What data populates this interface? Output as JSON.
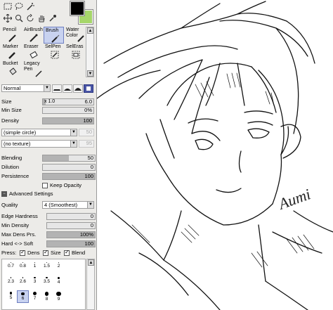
{
  "colors": {
    "foreground": "#000000",
    "background": "#a6d66a",
    "selection": "#c8d2f0"
  },
  "tools": {
    "icons": [
      "selection-tool-icon",
      "lasso-tool-icon",
      "magic-wand-icon",
      "move-tool-icon",
      "zoom-icon",
      "rotate-icon",
      "hand-icon",
      "eyedropper-icon"
    ]
  },
  "brushes": {
    "items": [
      {
        "label": "Pencil",
        "icon": "pencil-icon"
      },
      {
        "label": "AirBrush",
        "icon": "airbrush-icon"
      },
      {
        "label": "Brush",
        "icon": "brush-icon",
        "selected": true
      },
      {
        "label": "Water Color",
        "icon": "watercolor-icon"
      },
      {
        "label": "Marker",
        "icon": "marker-icon"
      },
      {
        "label": "Eraser",
        "icon": "eraser-icon"
      },
      {
        "label": "SelPen",
        "icon": "selpen-icon"
      },
      {
        "label": "SelEras",
        "icon": "seleras-icon"
      },
      {
        "label": "Bucket",
        "icon": "bucket-icon"
      },
      {
        "label": "Legacy Pen",
        "icon": "legacy-pen-icon"
      }
    ]
  },
  "blend_mode": {
    "value": "Normal"
  },
  "size": {
    "label": "Size",
    "multiplier": "x 1.0",
    "value": "6.0",
    "level": 0.06
  },
  "min_size": {
    "label": "Min Size",
    "value": "0%",
    "level": 0.0
  },
  "density": {
    "label": "Density",
    "value": "100",
    "level": 1.0
  },
  "shape": {
    "value": "(simple circle)",
    "amount": "50"
  },
  "texture": {
    "value": "(no texture)",
    "amount": "95"
  },
  "blending": {
    "label": "Blending",
    "value": "50",
    "level": 0.5
  },
  "dilution": {
    "label": "Dilution",
    "value": "0",
    "level": 0.0
  },
  "persistence": {
    "label": "Persistence",
    "value": "100",
    "level": 1.0
  },
  "keep_opacity": {
    "label": "Keep Opacity",
    "checked": false
  },
  "advanced": {
    "header": "Advanced Settings",
    "quality": {
      "label": "Quality",
      "value": "4 (Smoothest)"
    },
    "edge_hardness": {
      "label": "Edge Hardness",
      "value": "0",
      "level": 0.0
    },
    "min_density": {
      "label": "Min Density",
      "value": "0",
      "level": 0.0
    },
    "max_dens_prs": {
      "label": "Max Dens Prs.",
      "value": "100%",
      "level": 1.0
    },
    "hard_soft": {
      "label": "Hard <-> Soft",
      "value": "100",
      "level": 1.0
    },
    "press": {
      "label": "Press:",
      "dens": "Dens",
      "size": "Size",
      "blend": "Blend"
    }
  },
  "brush_sizes": {
    "row1": [
      "0.7",
      "0.8",
      "1",
      "1.5",
      "2"
    ],
    "row2": [
      "2.3",
      "2.6",
      "3",
      "3.5",
      "4"
    ],
    "row3": [
      "5",
      "6",
      "7",
      "8",
      "9"
    ],
    "selected": "6"
  },
  "canvas": {
    "signature": "Aumi"
  }
}
